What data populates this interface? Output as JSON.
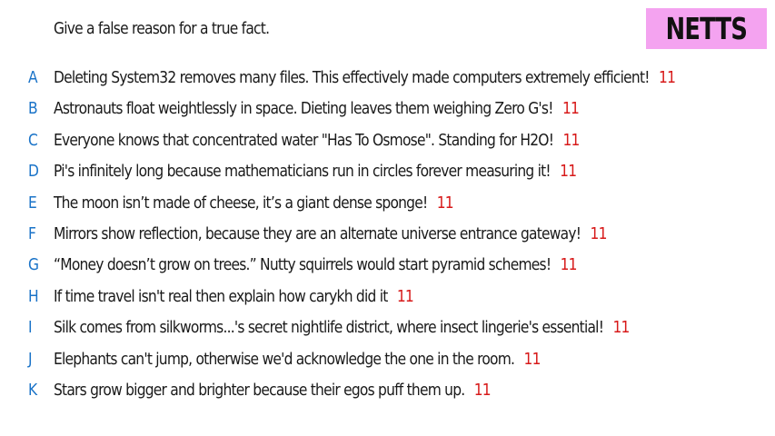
{
  "prompt": "Give a false reason for a true fact.",
  "logo": "NETTS",
  "colors": {
    "letter": "#1a73c8",
    "score": "#d71919",
    "logo_bg": "#f4a3f0"
  },
  "entries": [
    {
      "letter": "A",
      "text": "Deleting System32 removes many files. This effectively made computers extremely efficient!",
      "score": "11"
    },
    {
      "letter": "B",
      "text": "Astronauts float weightlessly in space. Dieting leaves them weighing Zero G's!",
      "score": "11"
    },
    {
      "letter": "C",
      "text": "Everyone knows that concentrated water \"Has To Osmose\". Standing for H2O!",
      "score": "11"
    },
    {
      "letter": "D",
      "text": "Pi's infinitely long because mathematicians run in circles forever measuring it!",
      "score": "11"
    },
    {
      "letter": "E",
      "text": "The moon isn’t made of cheese, it’s a giant dense sponge!",
      "score": "11"
    },
    {
      "letter": "F",
      "text": "Mirrors show reflection, because they are an alternate universe entrance gateway!",
      "score": "11"
    },
    {
      "letter": "G",
      "text": "“Money doesn’t grow on trees.” Nutty squirrels would start pyramid schemes!",
      "score": "11"
    },
    {
      "letter": "H",
      "text": "If time travel isn't real then explain how carykh did it",
      "score": "11"
    },
    {
      "letter": "I",
      "text": "Silk comes from silkworms...'s secret nightlife district, where insect lingerie's essential!",
      "score": "11"
    },
    {
      "letter": "J",
      "text": "Elephants can't jump, otherwise we'd acknowledge the one in the room.",
      "score": "11"
    },
    {
      "letter": "K",
      "text": "Stars grow bigger and brighter because their egos puff them up.",
      "score": "11"
    }
  ]
}
